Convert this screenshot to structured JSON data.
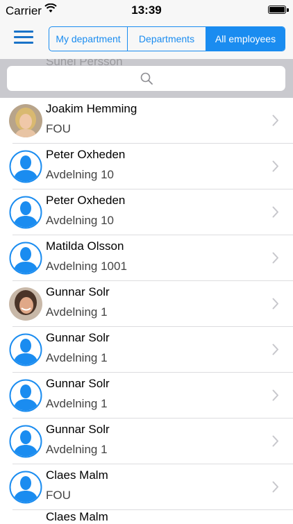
{
  "status_bar": {
    "carrier": "Carrier",
    "time": "13:39",
    "battery_level": 1.0
  },
  "nav": {
    "segments": [
      {
        "label": "My department",
        "active": false
      },
      {
        "label": "Departments",
        "active": false
      },
      {
        "label": "All employees",
        "active": true
      }
    ]
  },
  "search": {
    "placeholder": "",
    "behind_text": "Sunel Persson"
  },
  "employees": [
    {
      "name": "Joakim Hemming",
      "department": "FOU",
      "photo": "photo-woman-blonde"
    },
    {
      "name": "Peter Oxheden",
      "department": "Avdelning 10",
      "photo": "default-person-icon"
    },
    {
      "name": "Peter Oxheden",
      "department": "Avdelning 10",
      "photo": "default-person-icon"
    },
    {
      "name": "Matilda Olsson",
      "department": "Avdelning 1001",
      "photo": "default-person-icon"
    },
    {
      "name": "Gunnar Solr",
      "department": "Avdelning 1",
      "photo": "photo-woman-dark-hair"
    },
    {
      "name": "Gunnar Solr",
      "department": "Avdelning 1",
      "photo": "default-person-icon"
    },
    {
      "name": "Gunnar Solr",
      "department": "Avdelning 1",
      "photo": "default-person-icon"
    },
    {
      "name": "Gunnar Solr",
      "department": "Avdelning 1",
      "photo": "default-person-icon"
    },
    {
      "name": "Claes Malm",
      "department": "FOU",
      "photo": "default-person-icon"
    }
  ],
  "partial_row": {
    "name": "Claes Malm"
  },
  "colors": {
    "accent": "#1a8cf0",
    "search_bg": "#c9c9ce",
    "bar_bg": "#f7f7f7"
  }
}
